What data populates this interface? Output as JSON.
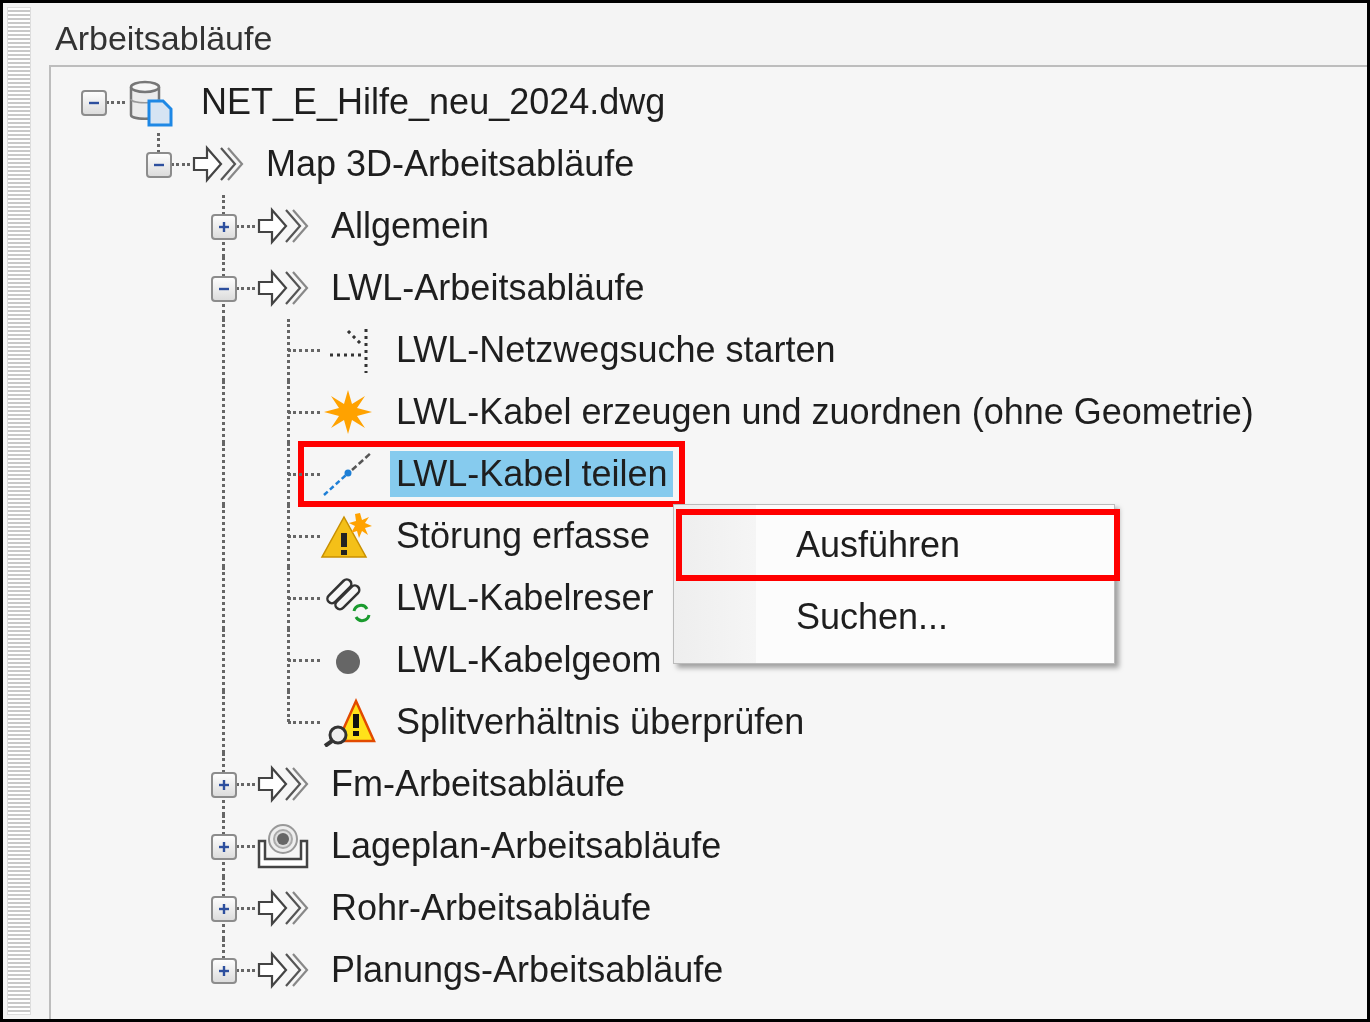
{
  "panel_title": "Arbeitsabläufe",
  "tree": [
    {
      "label": "NET_E_Hilfe_neu_2024.dwg",
      "kind": "drawing",
      "expanded": true,
      "selected": false,
      "annotated": false,
      "children": [
        {
          "label": "Map 3D-Arbeitsabläufe",
          "kind": "group",
          "expanded": true,
          "selected": false,
          "annotated": false,
          "children": [
            {
              "label": "Allgemein",
              "kind": "group",
              "expanded": false,
              "selected": false,
              "annotated": false
            },
            {
              "label": "LWL-Arbeitsabläufe",
              "kind": "group",
              "expanded": true,
              "selected": false,
              "annotated": false,
              "children": [
                {
                  "label": "LWL-Netzwegsuche starten",
                  "kind": "trace",
                  "selected": false,
                  "annotated": false
                },
                {
                  "label": "LWL-Kabel erzeugen und zuordnen (ohne Geometrie)",
                  "kind": "create",
                  "selected": false,
                  "annotated": false
                },
                {
                  "label": "LWL-Kabel teilen",
                  "kind": "split",
                  "selected": true,
                  "annotated": true
                },
                {
                  "label": "Störung erfasse",
                  "kind": "fault",
                  "selected": false,
                  "annotated": false
                },
                {
                  "label": "LWL-Kabelreser",
                  "kind": "reserve",
                  "selected": false,
                  "annotated": false
                },
                {
                  "label": "LWL-Kabelgeom",
                  "kind": "geometry",
                  "selected": false,
                  "annotated": false
                },
                {
                  "label": "Splitverhältnis überprüfen",
                  "kind": "check",
                  "selected": false,
                  "annotated": false
                }
              ]
            },
            {
              "label": "Fm-Arbeitsabläufe",
              "kind": "group",
              "expanded": false,
              "selected": false,
              "annotated": false
            },
            {
              "label": "Lageplan-Arbeitsabläufe",
              "kind": "siteplan",
              "expanded": false,
              "selected": false,
              "annotated": false
            },
            {
              "label": "Rohr-Arbeitsabläufe",
              "kind": "group",
              "expanded": false,
              "selected": false,
              "annotated": false
            },
            {
              "label": "Planungs-Arbeitsabläufe",
              "kind": "group",
              "expanded": false,
              "selected": false,
              "annotated": false
            }
          ]
        }
      ]
    }
  ],
  "context_menu": {
    "items": [
      {
        "label": "Ausführen",
        "annotated": true
      },
      {
        "label": "Suchen...",
        "annotated": false
      }
    ]
  }
}
